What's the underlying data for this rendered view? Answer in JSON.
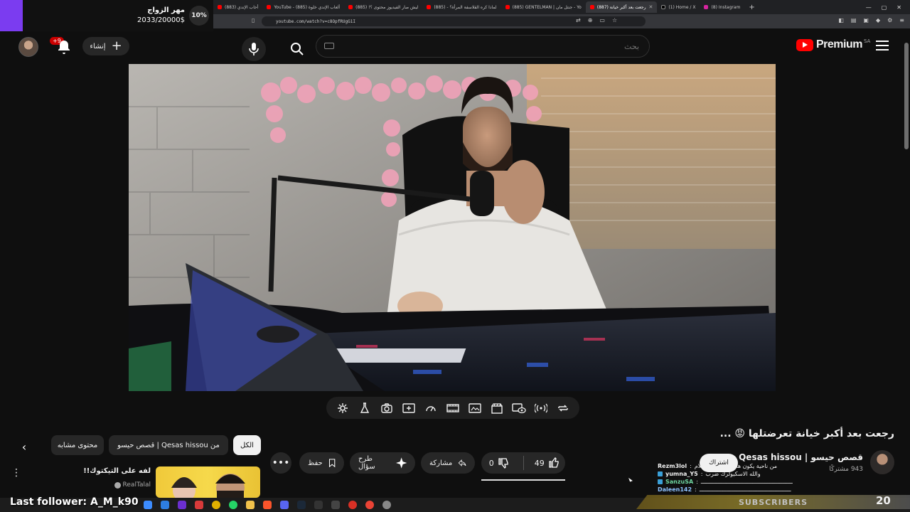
{
  "browser": {
    "tabs": [
      {
        "label": "أحاب الإندي (883)",
        "icon": "youtube-favicon",
        "active": false
      },
      {
        "label": "YouTube - ألعاب الإندي خلوة (885)",
        "icon": "youtube-favicon",
        "active": false
      },
      {
        "label": "ليش صار الفيديوز محتوى ؟! (885)",
        "icon": "youtube-favicon",
        "active": false
      },
      {
        "label": "لماذا كره القلاسفة المرأة؟ - (885)",
        "icon": "youtube-favicon",
        "active": false
      },
      {
        "label": "(885) GENTELMAN | جنتل مان - Yo",
        "icon": "youtube-favicon",
        "active": false
      },
      {
        "label": "(887) رجعت بعد أكبر خيانة",
        "icon": "youtube-favicon",
        "active": true
      },
      {
        "label": "(1) Home / X",
        "icon": "x-favicon",
        "active": false
      },
      {
        "label": "(8) Instagram",
        "icon": "instagram-favicon",
        "active": false
      }
    ],
    "url": "youtube.com/watch?v=c8OpfRUgG1I"
  },
  "goal_widget": {
    "title": "مهر الزواج",
    "progress_text": "2033/20000$",
    "percent": "10%",
    "accent": "#7b3cf0"
  },
  "masthead": {
    "notification_count": "+9",
    "create_label": "إنشاء",
    "search_placeholder": "بحث",
    "logo_text": "Premium",
    "country_code": "SA",
    "brand_color": "#ff0000"
  },
  "video": {
    "title": "رجعت بعد أكبر خيانة تعرضتلها 😡 ...",
    "channel_name": "قصص حيسو | Qesas hissou",
    "subscribers": "943 مشتركًا",
    "join_label": "اشتراك",
    "likes": "49",
    "dislikes": "0",
    "share_label": "مشاركة",
    "ask_label": "طرح سؤال",
    "save_label": "حفظ",
    "more_label": "•••"
  },
  "chips": {
    "all": "الكل",
    "from_channel": "من Qesas hissou | قصص حيسو",
    "similar": "محتوى مشابه"
  },
  "related": {
    "title": "لفه على التيكتوك!!",
    "channel": "RealTalal"
  },
  "chat": [
    {
      "user": "Rezm3lol",
      "msg": "من ناحية يكون هذي ومن كل الكلام"
    },
    {
      "user": "yumna_Y5",
      "msg": "والله الاسكيولرك ضرب"
    },
    {
      "user": "SanzuSA",
      "msg": "ـــــــــــــــــــــــــــــــــــــــــــــــــــــــ"
    },
    {
      "user": "Daleen142",
      "msg": "ـــــــــــــــــــــــــــــــــــــــــــــــــــــــ"
    }
  ],
  "overlay": {
    "last_follower": "Last follower: A_M_k90",
    "clock": "20",
    "subs_banner": "SUBSCRIBERS"
  },
  "taskbar": {
    "icons": [
      "windows-icon",
      "search-icon",
      "chrome-icon",
      "whatsapp-icon",
      "folder-icon",
      "brave-icon",
      "discord-icon",
      "steam-icon",
      "obs-icon",
      "terminal-icon"
    ]
  }
}
